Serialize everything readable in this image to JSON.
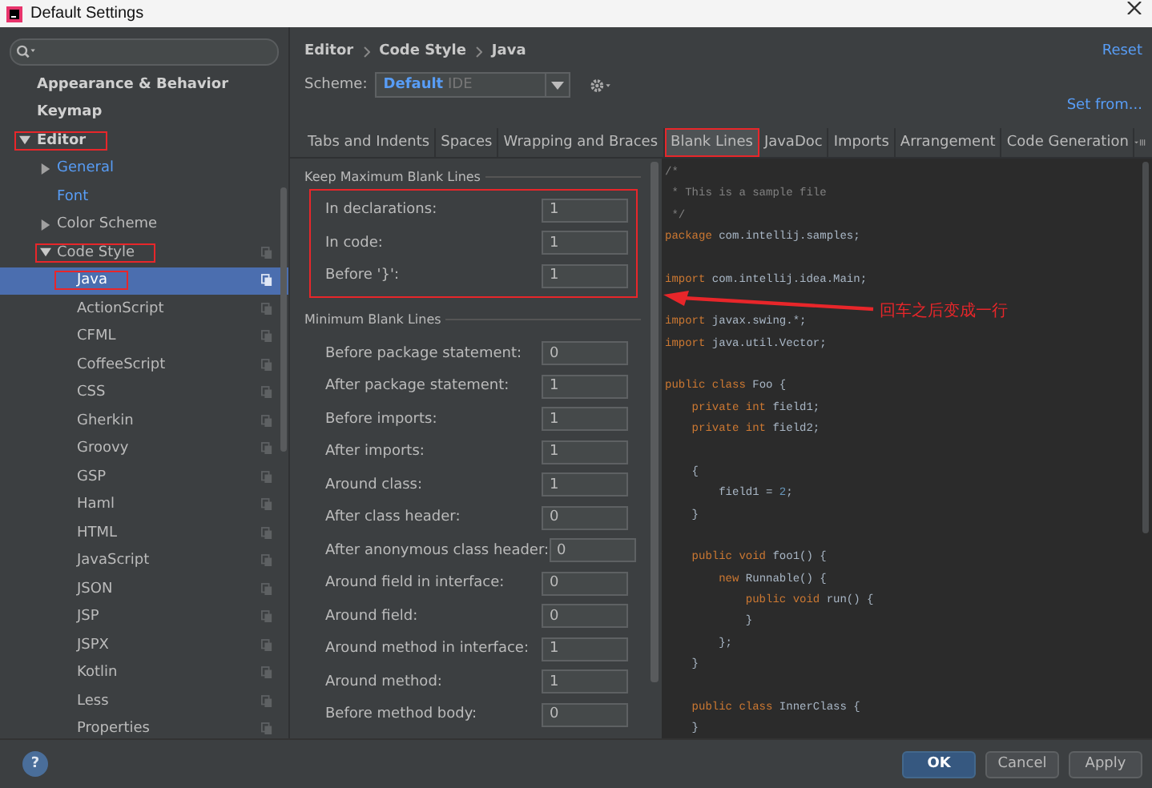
{
  "window": {
    "title": "Default Settings"
  },
  "sidebar": {
    "items": [
      {
        "label": "Appearance & Behavior",
        "selected": false
      },
      {
        "label": "Keymap",
        "selected": false
      },
      {
        "label": "Editor",
        "selected": false,
        "expanded": true,
        "marked": true,
        "children": [
          {
            "label": "General",
            "selected": false,
            "expanded": false,
            "modified": true
          },
          {
            "label": "Font",
            "selected": false,
            "modified": true
          },
          {
            "label": "Color Scheme",
            "selected": false,
            "expanded": false,
            "modified": false
          },
          {
            "label": "Code Style",
            "selected": false,
            "expanded": true,
            "modified": false,
            "marked": true,
            "scheme_icon": true,
            "children": [
              {
                "label": "Java",
                "selected": true,
                "marked": true,
                "scheme_icon": true
              },
              {
                "label": "ActionScript",
                "selected": false,
                "scheme_icon": true
              },
              {
                "label": "CFML",
                "selected": false,
                "scheme_icon": true
              },
              {
                "label": "CoffeeScript",
                "selected": false,
                "scheme_icon": true
              },
              {
                "label": "CSS",
                "selected": false,
                "scheme_icon": true
              },
              {
                "label": "Gherkin",
                "selected": false,
                "scheme_icon": true
              },
              {
                "label": "Groovy",
                "selected": false,
                "scheme_icon": true
              },
              {
                "label": "GSP",
                "selected": false,
                "scheme_icon": true
              },
              {
                "label": "Haml",
                "selected": false,
                "scheme_icon": true
              },
              {
                "label": "HTML",
                "selected": false,
                "scheme_icon": true
              },
              {
                "label": "JavaScript",
                "selected": false,
                "scheme_icon": true
              },
              {
                "label": "JSON",
                "selected": false,
                "scheme_icon": true
              },
              {
                "label": "JSP",
                "selected": false,
                "scheme_icon": true
              },
              {
                "label": "JSPX",
                "selected": false,
                "scheme_icon": true
              },
              {
                "label": "Kotlin",
                "selected": false,
                "scheme_icon": true
              },
              {
                "label": "Less",
                "selected": false,
                "scheme_icon": true
              },
              {
                "label": "Properties",
                "selected": false,
                "scheme_icon": true
              }
            ]
          }
        ]
      }
    ]
  },
  "breadcrumb": [
    "Editor",
    "Code Style",
    "Java"
  ],
  "reset_link": "Reset",
  "scheme": {
    "label": "Scheme:",
    "value": "Default",
    "hint": "IDE"
  },
  "set_from_link": "Set from...",
  "tabs": [
    {
      "label": "Tabs and Indents",
      "selected": false
    },
    {
      "label": "Spaces",
      "selected": false
    },
    {
      "label": "Wrapping and Braces",
      "selected": false
    },
    {
      "label": "Blank Lines",
      "selected": true,
      "marked": true
    },
    {
      "label": "JavaDoc",
      "selected": false
    },
    {
      "label": "Imports",
      "selected": false
    },
    {
      "label": "Arrangement",
      "selected": false
    },
    {
      "label": "Code Generation",
      "selected": false
    }
  ],
  "sections": [
    {
      "title": "Keep Maximum Blank Lines",
      "marked": true,
      "rows": [
        {
          "label": "In declarations:",
          "value": "1"
        },
        {
          "label": "In code:",
          "value": "1"
        },
        {
          "label": "Before '}':",
          "value": "1"
        }
      ]
    },
    {
      "title": "Minimum Blank Lines",
      "marked": false,
      "rows": [
        {
          "label": "Before package statement:",
          "value": "0"
        },
        {
          "label": "After package statement:",
          "value": "1"
        },
        {
          "label": "Before imports:",
          "value": "1"
        },
        {
          "label": "After imports:",
          "value": "1"
        },
        {
          "label": "Around class:",
          "value": "1"
        },
        {
          "label": "After class header:",
          "value": "0"
        },
        {
          "label": "After anonymous class header:",
          "value": "0"
        },
        {
          "label": "Around field in interface:",
          "value": "0"
        },
        {
          "label": "Around field:",
          "value": "0"
        },
        {
          "label": "Around method in interface:",
          "value": "1"
        },
        {
          "label": "Around method:",
          "value": "1"
        },
        {
          "label": "Before method body:",
          "value": "0"
        }
      ]
    }
  ],
  "code_preview": {
    "blocks": [
      {
        "lines": [
          {
            "tokens": [
              {
                "kind": "comment",
                "text": "/*"
              }
            ]
          },
          {
            "tokens": [
              {
                "kind": "comment",
                "text": " * This is a sample file"
              }
            ]
          },
          {
            "tokens": [
              {
                "kind": "comment",
                "text": " */"
              }
            ]
          },
          {
            "tokens": [
              {
                "kind": "keyword",
                "text": "package"
              },
              {
                "kind": "plain",
                "text": " com.intellij.samples;"
              }
            ]
          }
        ]
      },
      {
        "lines": [
          {
            "tokens": [
              {
                "kind": "keyword",
                "text": "import"
              },
              {
                "kind": "plain",
                "text": " com.intellij.idea.Main;"
              }
            ]
          }
        ]
      },
      {
        "lines": [
          {
            "tokens": [
              {
                "kind": "keyword",
                "text": "import"
              },
              {
                "kind": "plain",
                "text": " javax.swing.*;"
              }
            ]
          },
          {
            "tokens": [
              {
                "kind": "keyword",
                "text": "import"
              },
              {
                "kind": "plain",
                "text": " java.util.Vector;"
              }
            ]
          }
        ]
      },
      {
        "lines": [
          {
            "tokens": [
              {
                "kind": "keyword",
                "text": "public class"
              },
              {
                "kind": "plain",
                "text": " Foo {"
              }
            ]
          },
          {
            "tokens": [
              {
                "kind": "keyword",
                "text": "    private int"
              },
              {
                "kind": "plain",
                "text": " field1;"
              }
            ]
          },
          {
            "tokens": [
              {
                "kind": "keyword",
                "text": "    private int"
              },
              {
                "kind": "plain",
                "text": " field2;"
              }
            ]
          }
        ]
      },
      {
        "lines": [
          {
            "tokens": [
              {
                "kind": "plain",
                "text": "    {"
              }
            ]
          },
          {
            "tokens": [
              {
                "kind": "plain",
                "text": "        field1 = "
              },
              {
                "kind": "number",
                "text": "2"
              },
              {
                "kind": "plain",
                "text": ";"
              }
            ]
          },
          {
            "tokens": [
              {
                "kind": "plain",
                "text": "    }"
              }
            ]
          }
        ]
      },
      {
        "lines": [
          {
            "tokens": [
              {
                "kind": "keyword",
                "text": "    public void"
              },
              {
                "kind": "plain",
                "text": " foo1() {"
              }
            ]
          },
          {
            "tokens": [
              {
                "kind": "keyword",
                "text": "        new"
              },
              {
                "kind": "plain",
                "text": " Runnable() {"
              }
            ]
          },
          {
            "tokens": [
              {
                "kind": "keyword",
                "text": "            public void"
              },
              {
                "kind": "plain",
                "text": " run() {"
              }
            ]
          },
          {
            "tokens": [
              {
                "kind": "plain",
                "text": "            }"
              }
            ]
          },
          {
            "tokens": [
              {
                "kind": "plain",
                "text": "        };"
              }
            ]
          },
          {
            "tokens": [
              {
                "kind": "plain",
                "text": "    }"
              }
            ]
          }
        ]
      },
      {
        "lines": [
          {
            "tokens": [
              {
                "kind": "keyword",
                "text": "    public class"
              },
              {
                "kind": "plain",
                "text": " InnerClass {"
              }
            ]
          },
          {
            "tokens": [
              {
                "kind": "plain",
                "text": "    }"
              }
            ]
          }
        ]
      }
    ]
  },
  "annotation": {
    "text": "回车之后变成一行"
  },
  "help": "?",
  "buttons": [
    {
      "label": "OK",
      "kind": "primary"
    },
    {
      "label": "Cancel",
      "kind": "normal"
    },
    {
      "label": "Apply",
      "kind": "normal"
    }
  ]
}
